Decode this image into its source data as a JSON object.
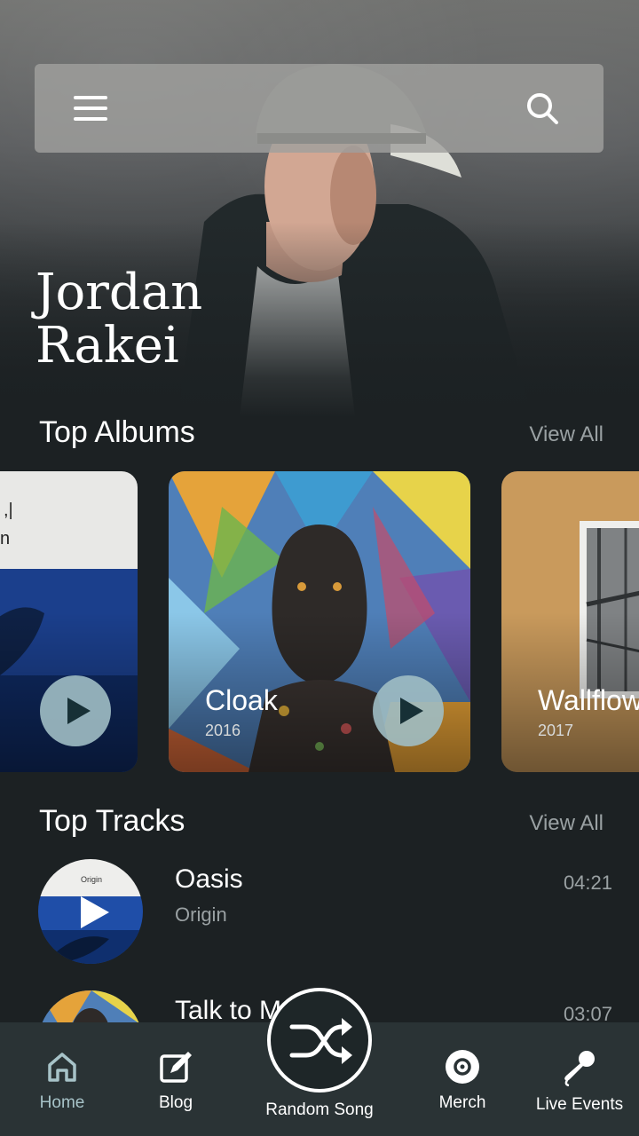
{
  "artist": {
    "name_line1": "Jordan",
    "name_line2": "Rakei"
  },
  "top_albums": {
    "title": "Top Albums",
    "view_all": "View All",
    "items": [
      {
        "title": "",
        "year": ""
      },
      {
        "title": "Cloak",
        "year": "2016"
      },
      {
        "title": "Wallflower",
        "year": "2017"
      }
    ]
  },
  "top_tracks": {
    "title": "Top Tracks",
    "view_all": "View All",
    "items": [
      {
        "title": "Oasis",
        "album": "Origin",
        "duration": "04:21"
      },
      {
        "title": "Talk to Me",
        "album": "",
        "duration": "03:07"
      }
    ]
  },
  "nav": {
    "home": "Home",
    "blog": "Blog",
    "random_song": "Random Song",
    "merch": "Merch",
    "live_events": "Live Events"
  },
  "colors": {
    "background": "#1c2123",
    "nav_bg": "#2a3335",
    "accent": "#a7c3c8",
    "muted": "#9aa1a3"
  }
}
